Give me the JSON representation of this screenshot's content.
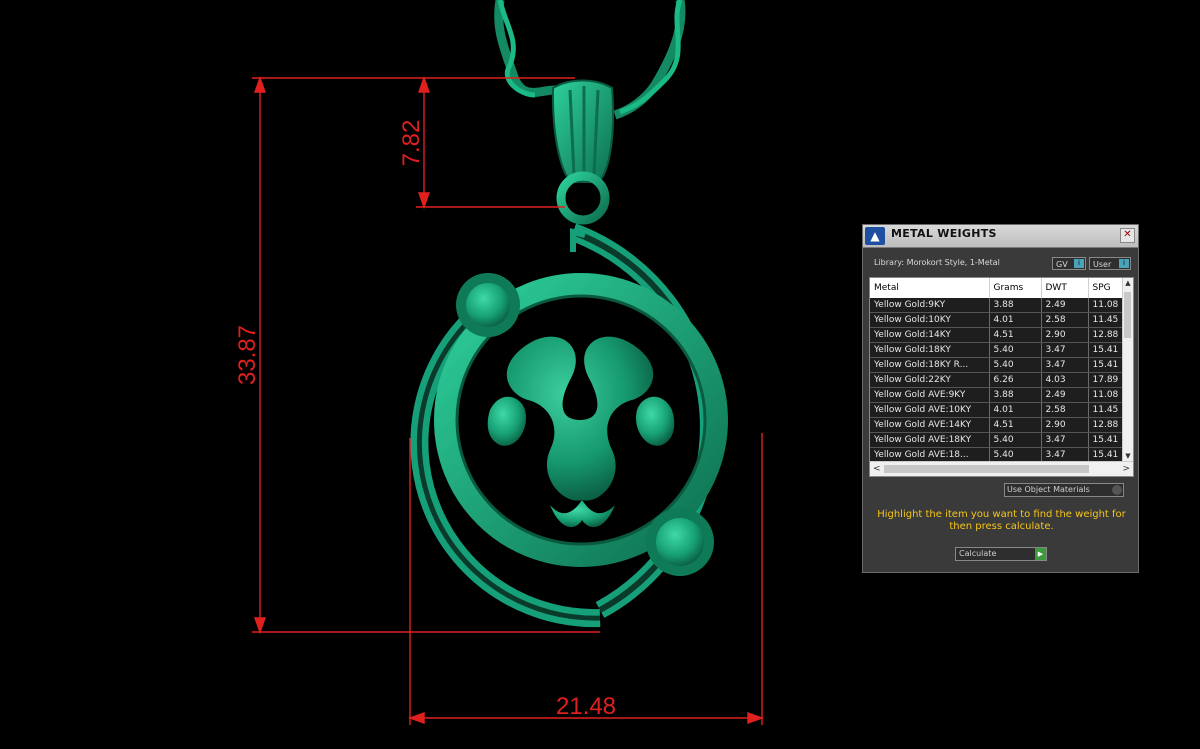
{
  "dimensions": {
    "height_total": "33.87",
    "bail_height": "7.82",
    "width": "21.48",
    "line_color": "#e0201e"
  },
  "model": {
    "color": "#19a37a",
    "description_icon": "pendant-model"
  },
  "panel": {
    "title": "METAL WEIGHTS",
    "library": "Library: Morokort Style, 1-Metal",
    "toggle_gv": "GV",
    "toggle_user": "User",
    "columns": [
      "Metal",
      "Grams",
      "DWT",
      "SPG"
    ],
    "rows": [
      [
        "Yellow Gold:9KY",
        "3.88",
        "2.49",
        "11.08"
      ],
      [
        "Yellow Gold:10KY",
        "4.01",
        "2.58",
        "11.45"
      ],
      [
        "Yellow Gold:14KY",
        "4.51",
        "2.90",
        "12.88"
      ],
      [
        "Yellow Gold:18KY",
        "5.40",
        "3.47",
        "15.41"
      ],
      [
        "Yellow Gold:18KY R...",
        "5.40",
        "3.47",
        "15.41"
      ],
      [
        "Yellow Gold:22KY",
        "6.26",
        "4.03",
        "17.89"
      ],
      [
        "Yellow Gold AVE:9KY",
        "3.88",
        "2.49",
        "11.08"
      ],
      [
        "Yellow Gold AVE:10KY",
        "4.01",
        "2.58",
        "11.45"
      ],
      [
        "Yellow Gold AVE:14KY",
        "4.51",
        "2.90",
        "12.88"
      ],
      [
        "Yellow Gold AVE:18KY",
        "5.40",
        "3.47",
        "15.41"
      ],
      [
        "Yellow Gold AVE:18...",
        "5.40",
        "3.47",
        "15.41"
      ]
    ],
    "use_object_materials": "Use Object Materials",
    "hint": "Highlight the item you want to find the weight for then press calculate.",
    "calculate": "Calculate",
    "accent": "#f5c518"
  }
}
